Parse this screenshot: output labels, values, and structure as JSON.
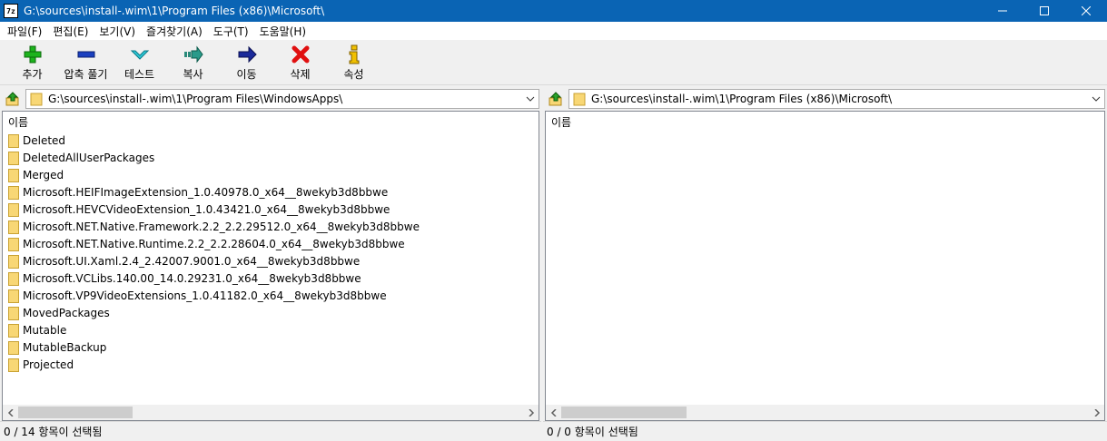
{
  "window": {
    "app_icon_text": "7z",
    "title": "G:\\sources\\install-.wim\\1\\Program Files (x86)\\Microsoft\\"
  },
  "menu": [
    "파일(F)",
    "편집(E)",
    "보기(V)",
    "즐겨찾기(A)",
    "도구(T)",
    "도움말(H)"
  ],
  "toolbar": [
    {
      "label": "추가",
      "icon": "add-icon"
    },
    {
      "label": "압축 풀기",
      "icon": "extract-icon"
    },
    {
      "label": "테스트",
      "icon": "test-icon"
    },
    {
      "label": "복사",
      "icon": "copy-icon"
    },
    {
      "label": "이동",
      "icon": "move-icon"
    },
    {
      "label": "삭제",
      "icon": "delete-icon"
    },
    {
      "label": "속성",
      "icon": "info-icon"
    }
  ],
  "left_pane": {
    "path": "G:\\sources\\install-.wim\\1\\Program Files\\WindowsApps\\",
    "column_name": "이름",
    "items": [
      "Deleted",
      "DeletedAllUserPackages",
      "Merged",
      "Microsoft.HEIFImageExtension_1.0.40978.0_x64__8wekyb3d8bbwe",
      "Microsoft.HEVCVideoExtension_1.0.43421.0_x64__8wekyb3d8bbwe",
      "Microsoft.NET.Native.Framework.2.2_2.2.29512.0_x64__8wekyb3d8bbwe",
      "Microsoft.NET.Native.Runtime.2.2_2.2.28604.0_x64__8wekyb3d8bbwe",
      "Microsoft.UI.Xaml.2.4_2.42007.9001.0_x64__8wekyb3d8bbwe",
      "Microsoft.VCLibs.140.00_14.0.29231.0_x64__8wekyb3d8bbwe",
      "Microsoft.VP9VideoExtensions_1.0.41182.0_x64__8wekyb3d8bbwe",
      "MovedPackages",
      "Mutable",
      "MutableBackup",
      "Projected"
    ],
    "status": "0 / 14 항목이 선택됨"
  },
  "right_pane": {
    "path": "G:\\sources\\install-.wim\\1\\Program Files (x86)\\Microsoft\\",
    "column_name": "이름",
    "items": [],
    "status": "0 / 0 항목이 선택됨"
  },
  "colors": {
    "titlebar": "#0a64b4",
    "folder": "#f8d775"
  }
}
